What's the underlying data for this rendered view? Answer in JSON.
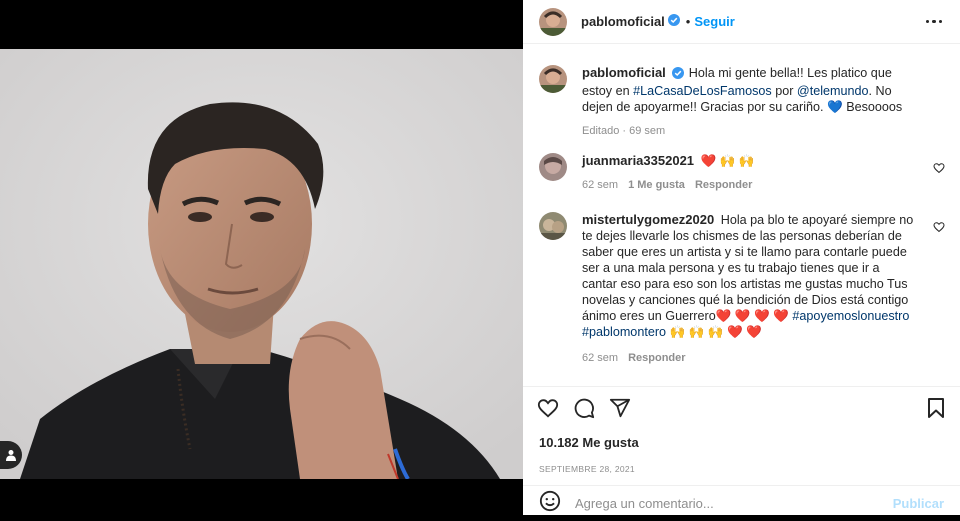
{
  "post": {
    "username": "pablomoficial",
    "follow_label": "Seguir",
    "separator": "•"
  },
  "caption": {
    "username": "pablomoficial",
    "text_1": "Hola mi gente bella!! Les platico que estoy en ",
    "hashtag": "#LaCasaDeLosFamosos",
    "text_2": " por ",
    "mention": "@telemundo",
    "text_3": ". No dejen de apoyarme!! Gracias por su cariño. ",
    "emoji": "💙",
    "text_4": " Besoooos",
    "edited_label": "Editado",
    "time": "69 sem"
  },
  "comments": [
    {
      "username": "juanmaria3352021",
      "text": "❤️ 🙌 🙌",
      "time": "62 sem",
      "likes": "1 Me gusta",
      "reply_label": "Responder"
    },
    {
      "username": "mistertulygomez2020",
      "text": "Hola pa blo te apoyaré siempre no te dejes llevarle los chismes de las personas deberían de saber que eres un artista y si te llamo para contarle puede ser a una mala persona y es tu trabajo tienes que ir a cantar eso para eso son los artistas me gustas mucho Tus novelas y canciones qué la bendición de Dios está contigo ánimo eres un Guerrero❤️ ❤️ ❤️ ❤️ ",
      "hashtag_1": "#apoyemoslonuestro",
      "hashtag_2": "#pablomontero",
      "text_end": " 🙌 🙌 🙌 ❤️ ❤️",
      "time": "62 sem",
      "reply_label": "Responder"
    }
  ],
  "stats": {
    "likes": "10.182 Me gusta",
    "date": "SEPTIEMBRE 28, 2021"
  },
  "composer": {
    "placeholder": "Agrega un comentario...",
    "publish_label": "Publicar"
  },
  "colors": {
    "accent": "#0095f6",
    "verified": "#3897f0",
    "link": "#00376b",
    "muted": "#8e8e8e",
    "heart": "#ed4956"
  },
  "icons": [
    "verified-badge-icon",
    "more-options-icon",
    "heart-icon",
    "comment-icon",
    "share-icon",
    "bookmark-icon",
    "emoji-icon",
    "user-tag-icon"
  ]
}
